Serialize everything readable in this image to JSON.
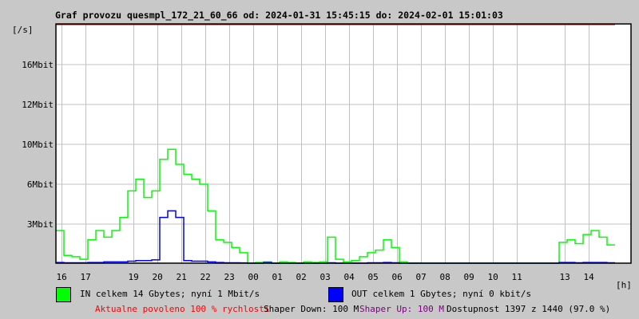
{
  "chart_data": {
    "type": "line",
    "title": "Graf provozu quesmpl_172_21_60_66 od: 2024-01-31 15:45:15 do: 2024-02-01 15:01:03",
    "ylabel": "[/s]",
    "xlabel": "[h]",
    "y_ticks": [
      {
        "label": "3Mbit",
        "value": 3
      },
      {
        "label": "6Mbit",
        "value": 6
      },
      {
        "label": "10Mbit",
        "value": 10
      },
      {
        "label": "12Mbit",
        "value": 12
      },
      {
        "label": "16Mbit",
        "value": 16
      }
    ],
    "ylim": [
      0,
      20
    ],
    "x_start_hour": 15.75,
    "x_range_hours": 24,
    "x_ticks": [
      {
        "label": "16",
        "hour": 16
      },
      {
        "label": "17",
        "hour": 17
      },
      {
        "label": "19",
        "hour": 19
      },
      {
        "label": "20",
        "hour": 20
      },
      {
        "label": "21",
        "hour": 21
      },
      {
        "label": "22",
        "hour": 22
      },
      {
        "label": "23",
        "hour": 23
      },
      {
        "label": "00",
        "hour": 24
      },
      {
        "label": "01",
        "hour": 25
      },
      {
        "label": "02",
        "hour": 26
      },
      {
        "label": "03",
        "hour": 27
      },
      {
        "label": "04",
        "hour": 28
      },
      {
        "label": "05",
        "hour": 29
      },
      {
        "label": "06",
        "hour": 30
      },
      {
        "label": "07",
        "hour": 31
      },
      {
        "label": "08",
        "hour": 32
      },
      {
        "label": "09",
        "hour": 33
      },
      {
        "label": "10",
        "hour": 34
      },
      {
        "label": "11",
        "hour": 35
      },
      {
        "label": "13",
        "hour": 37
      },
      {
        "label": "14",
        "hour": 38
      }
    ],
    "grid": true,
    "interval_minutes": 20,
    "series": [
      {
        "name": "IN",
        "color": "#00ff00",
        "unit": "Mbit/s",
        "values": [
          2.5,
          0.6,
          0.5,
          0.3,
          1.8,
          2.5,
          2.0,
          2.5,
          3.5,
          5.5,
          6.5,
          5.0,
          5.5,
          8.5,
          9.5,
          8.0,
          7.0,
          6.5,
          6.0,
          4.0,
          1.8,
          1.6,
          1.2,
          0.8,
          0.0,
          0.05,
          0.1,
          0.0,
          0.1,
          0.05,
          0.0,
          0.1,
          0.05,
          0.1,
          2.0,
          0.3,
          0.1,
          0.2,
          0.5,
          0.8,
          1.0,
          1.8,
          1.2,
          0.1,
          0,
          0,
          0,
          0,
          0,
          0,
          0,
          0,
          0,
          0,
          0,
          0,
          0,
          0,
          0,
          0,
          0,
          0,
          0,
          1.6,
          1.8,
          1.5,
          2.2,
          2.5,
          2.0,
          1.4
        ]
      },
      {
        "name": "OUT",
        "color": "#0000ff",
        "unit": "Mbit/s",
        "values": [
          0.05,
          0.03,
          0.03,
          0.03,
          0.05,
          0.05,
          0.1,
          0.1,
          0.1,
          0.15,
          0.2,
          0.2,
          0.25,
          3.5,
          4.0,
          3.5,
          0.2,
          0.15,
          0.15,
          0.1,
          0.05,
          0.03,
          0.03,
          0.02,
          0.0,
          0,
          0.05,
          0,
          0,
          0,
          0,
          0,
          0,
          0,
          0.03,
          0,
          0,
          0,
          0,
          0.03,
          0.03,
          0.05,
          0.03,
          0,
          0,
          0,
          0,
          0,
          0,
          0,
          0,
          0,
          0,
          0,
          0,
          0,
          0,
          0,
          0,
          0,
          0,
          0,
          0,
          0.05,
          0.05,
          0.03,
          0.05,
          0.05,
          0.05,
          0.03
        ]
      }
    ]
  },
  "legend": {
    "in_text": "IN celkem 14 Gbytes; nyní 1 Mbit/s",
    "out_text": "OUT celkem 1 Gbytes; nyní 0 kbit/s",
    "in_color": "#00ff00",
    "out_color": "#0000ff"
  },
  "status": {
    "allowed": "Aktualne povoleno 100 % rychlosti",
    "shaper_down": "Shaper Down: 100 M",
    "shaper_up": "Shaper Up: 100 M",
    "availability": "Dostupnost 1397 z 1440 (97.0 %)",
    "allowed_color": "#ff0000",
    "shaper_up_color": "#800080"
  }
}
